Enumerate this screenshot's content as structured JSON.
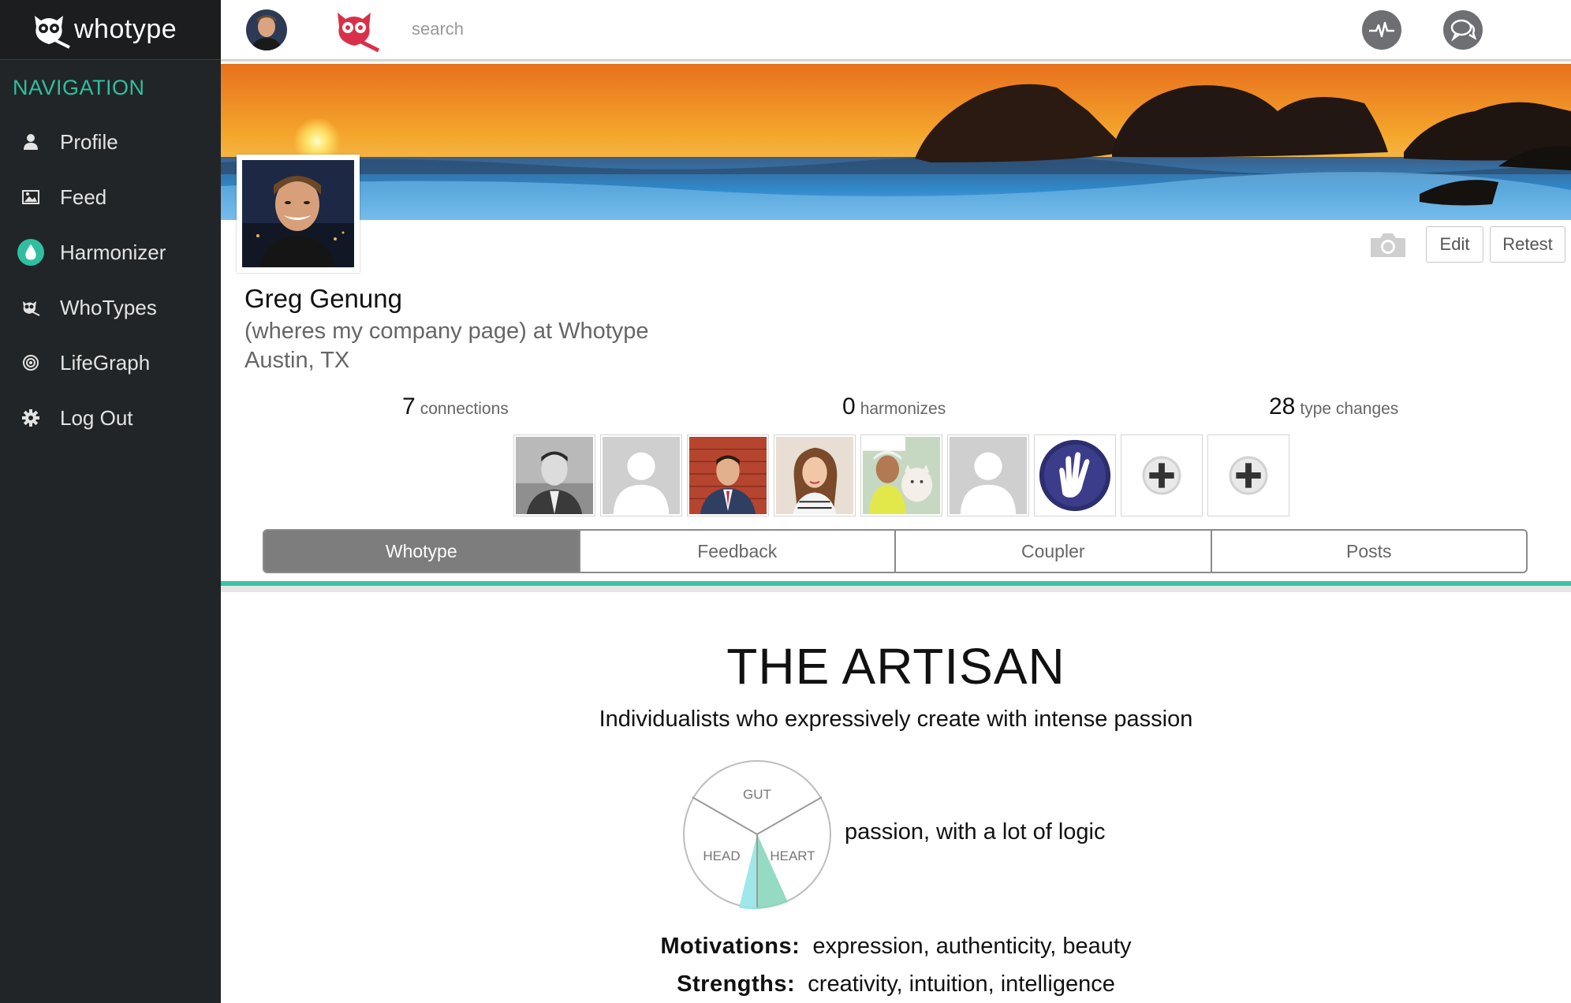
{
  "app": {
    "logo_text": "whotype"
  },
  "sidebar": {
    "heading": "NAVIGATION",
    "items": [
      {
        "label": "Profile",
        "icon": "user-icon"
      },
      {
        "label": "Feed",
        "icon": "image-icon"
      },
      {
        "label": "Harmonizer",
        "icon": "drop-icon"
      },
      {
        "label": "WhoTypes",
        "icon": "owl-icon"
      },
      {
        "label": "LifeGraph",
        "icon": "target-icon"
      },
      {
        "label": "Log Out",
        "icon": "gear-icon"
      }
    ]
  },
  "topbar": {
    "search_placeholder": "search",
    "icons": [
      "avatar",
      "owl-logo-icon",
      "pulse-icon",
      "chat-icon"
    ]
  },
  "profile": {
    "name": "Greg Genung",
    "company_line": "(wheres my company page) at Whotype",
    "location": "Austin, TX",
    "edit_label": "Edit",
    "retest_label": "Retest"
  },
  "stats": {
    "connections": {
      "value": "7",
      "label": "connections"
    },
    "harmonizes": {
      "value": "0",
      "label": "harmonizes"
    },
    "type_changes": {
      "value": "28",
      "label": "type changes"
    }
  },
  "connections_thumbs": [
    "person-photo",
    "placeholder-avatar",
    "person-photo",
    "person-photo",
    "person-photo",
    "placeholder-avatar",
    "hand-logo",
    "add",
    "add"
  ],
  "tabs": [
    {
      "label": "Whotype",
      "active": true
    },
    {
      "label": "Feedback",
      "active": false
    },
    {
      "label": "Coupler",
      "active": false
    },
    {
      "label": "Posts",
      "active": false
    }
  ],
  "type": {
    "title": "THE ARTISAN",
    "subtitle": "Individualists who expressively create with intense passion",
    "wheel_labels": {
      "gut": "GUT",
      "head": "HEAD",
      "heart": "HEART"
    },
    "wheel_desc": "passion, with a lot of logic",
    "motivations_label": "Motivations:",
    "motivations": "expression, authenticity, beauty",
    "strengths_label": "Strengths:",
    "strengths": "creativity, intuition, intelligence"
  },
  "colors": {
    "accent": "#3cc3a6",
    "sidebar_bg": "#222527",
    "owl_red": "#d9304a"
  }
}
